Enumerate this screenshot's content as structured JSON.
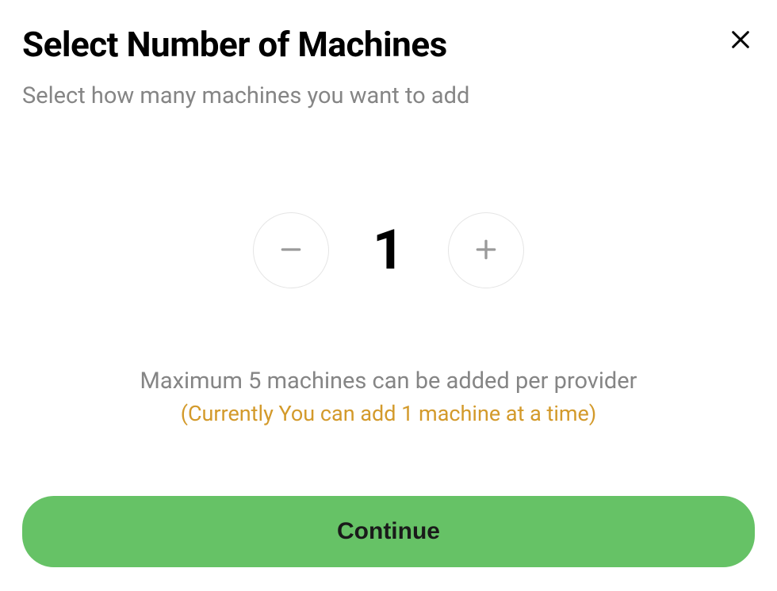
{
  "dialog": {
    "title": "Select Number of Machines",
    "subtitle": "Select how many machines you want to add"
  },
  "stepper": {
    "value": "1"
  },
  "info": {
    "max": "Maximum 5 machines can be added per provider",
    "current": "(Currently You can add 1 machine at a time)"
  },
  "actions": {
    "continue_label": "Continue"
  }
}
